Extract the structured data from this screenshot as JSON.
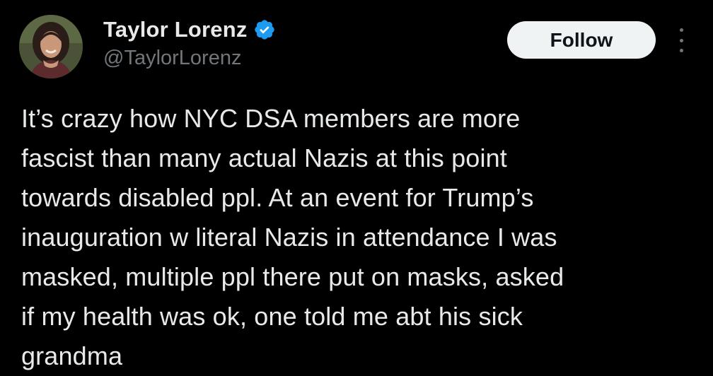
{
  "author": {
    "display_name": "Taylor Lorenz",
    "handle": "@TaylorLorenz",
    "verified": true,
    "avatar_icon": "avatar-photo",
    "verified_icon": "verified-badge-icon"
  },
  "actions": {
    "follow_label": "Follow",
    "more_icon": "more-options-icon"
  },
  "tweet": {
    "lines": [
      "It’s crazy how NYC DSA members are more",
      "fascist than many actual Nazis at this point",
      "towards disabled ppl. At an event for Trump’s",
      "inauguration w literal Nazis in attendance I was",
      "masked, multiple ppl there put on masks, asked",
      "if my health was ok, one told me abt his sick",
      "grandma"
    ]
  },
  "colors": {
    "background": "#000000",
    "text_primary": "#e7e9ea",
    "text_secondary": "#71767b",
    "verified_blue": "#1d9bf0",
    "follow_button_bg": "#eff3f4",
    "follow_button_text": "#0f1419"
  }
}
